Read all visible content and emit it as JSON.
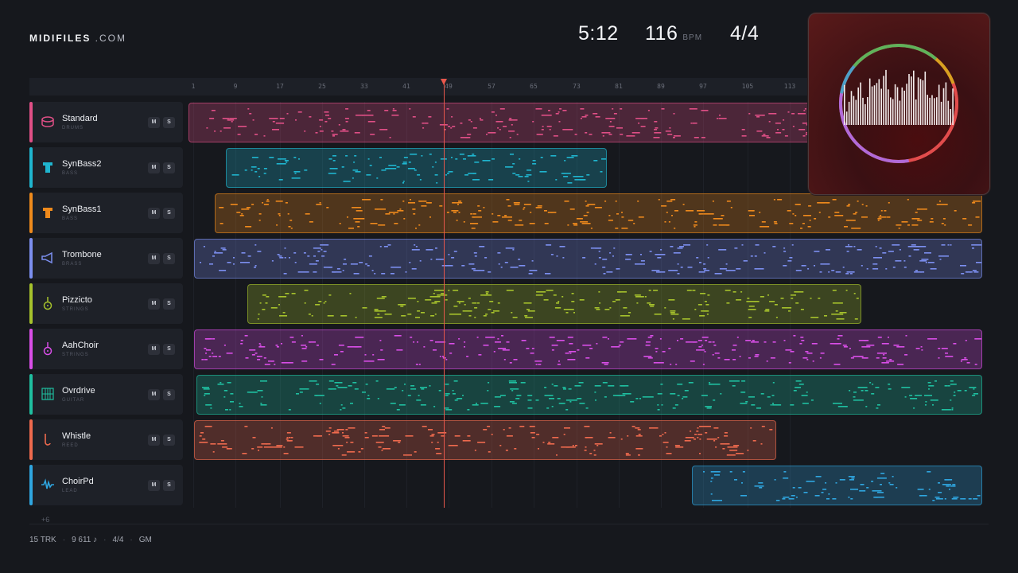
{
  "header": {
    "logo_bold": "MIDIFILES",
    "logo_light": " .COM",
    "time": "5:12",
    "tempo": "116",
    "tempo_unit": "BPM",
    "time_signature": "4/4"
  },
  "ruler": {
    "ticks": [
      "1",
      "9",
      "17",
      "25",
      "33",
      "41",
      "49",
      "57",
      "65",
      "73",
      "81",
      "89",
      "97",
      "105",
      "113"
    ]
  },
  "tracks": [
    {
      "name": "Standard",
      "category": "DRUMS",
      "color": "#e04f86",
      "icon": "drum-icon",
      "mute": "M",
      "solo": "S"
    },
    {
      "name": "SynBass2",
      "category": "BASS",
      "color": "#1fb5cf",
      "icon": "bass-icon",
      "mute": "M",
      "solo": "S"
    },
    {
      "name": "SynBass1",
      "category": "BASS",
      "color": "#ef8a1c",
      "icon": "bass-icon",
      "mute": "M",
      "solo": "S"
    },
    {
      "name": "Trombone",
      "category": "BRASS",
      "color": "#7c8ff0",
      "icon": "horn-icon",
      "mute": "M",
      "solo": "S"
    },
    {
      "name": "Pizzicto",
      "category": "STRINGS",
      "color": "#a6c22c",
      "icon": "violin-icon",
      "mute": "M",
      "solo": "S"
    },
    {
      "name": "AahChoir",
      "category": "STRINGS",
      "color": "#d94ee8",
      "icon": "violin-icon",
      "mute": "M",
      "solo": "S"
    },
    {
      "name": "Ovrdrive",
      "category": "GUITAR",
      "color": "#1fbfa0",
      "icon": "guitar-icon",
      "mute": "M",
      "solo": "S"
    },
    {
      "name": "Whistle",
      "category": "REED",
      "color": "#ef6a4e",
      "icon": "reed-icon",
      "mute": "M",
      "solo": "S"
    },
    {
      "name": "ChoirPd",
      "category": "LEAD",
      "color": "#2fa6e0",
      "icon": "wave-icon",
      "mute": "M",
      "solo": "S"
    }
  ],
  "more_tracks": "+6",
  "footer": {
    "tracks": "15 TRK",
    "notes": "9 611 ♪",
    "meter": "4/4",
    "format": "GM"
  },
  "colors": {
    "background": "#16181d",
    "playhead": "#e8574c"
  }
}
